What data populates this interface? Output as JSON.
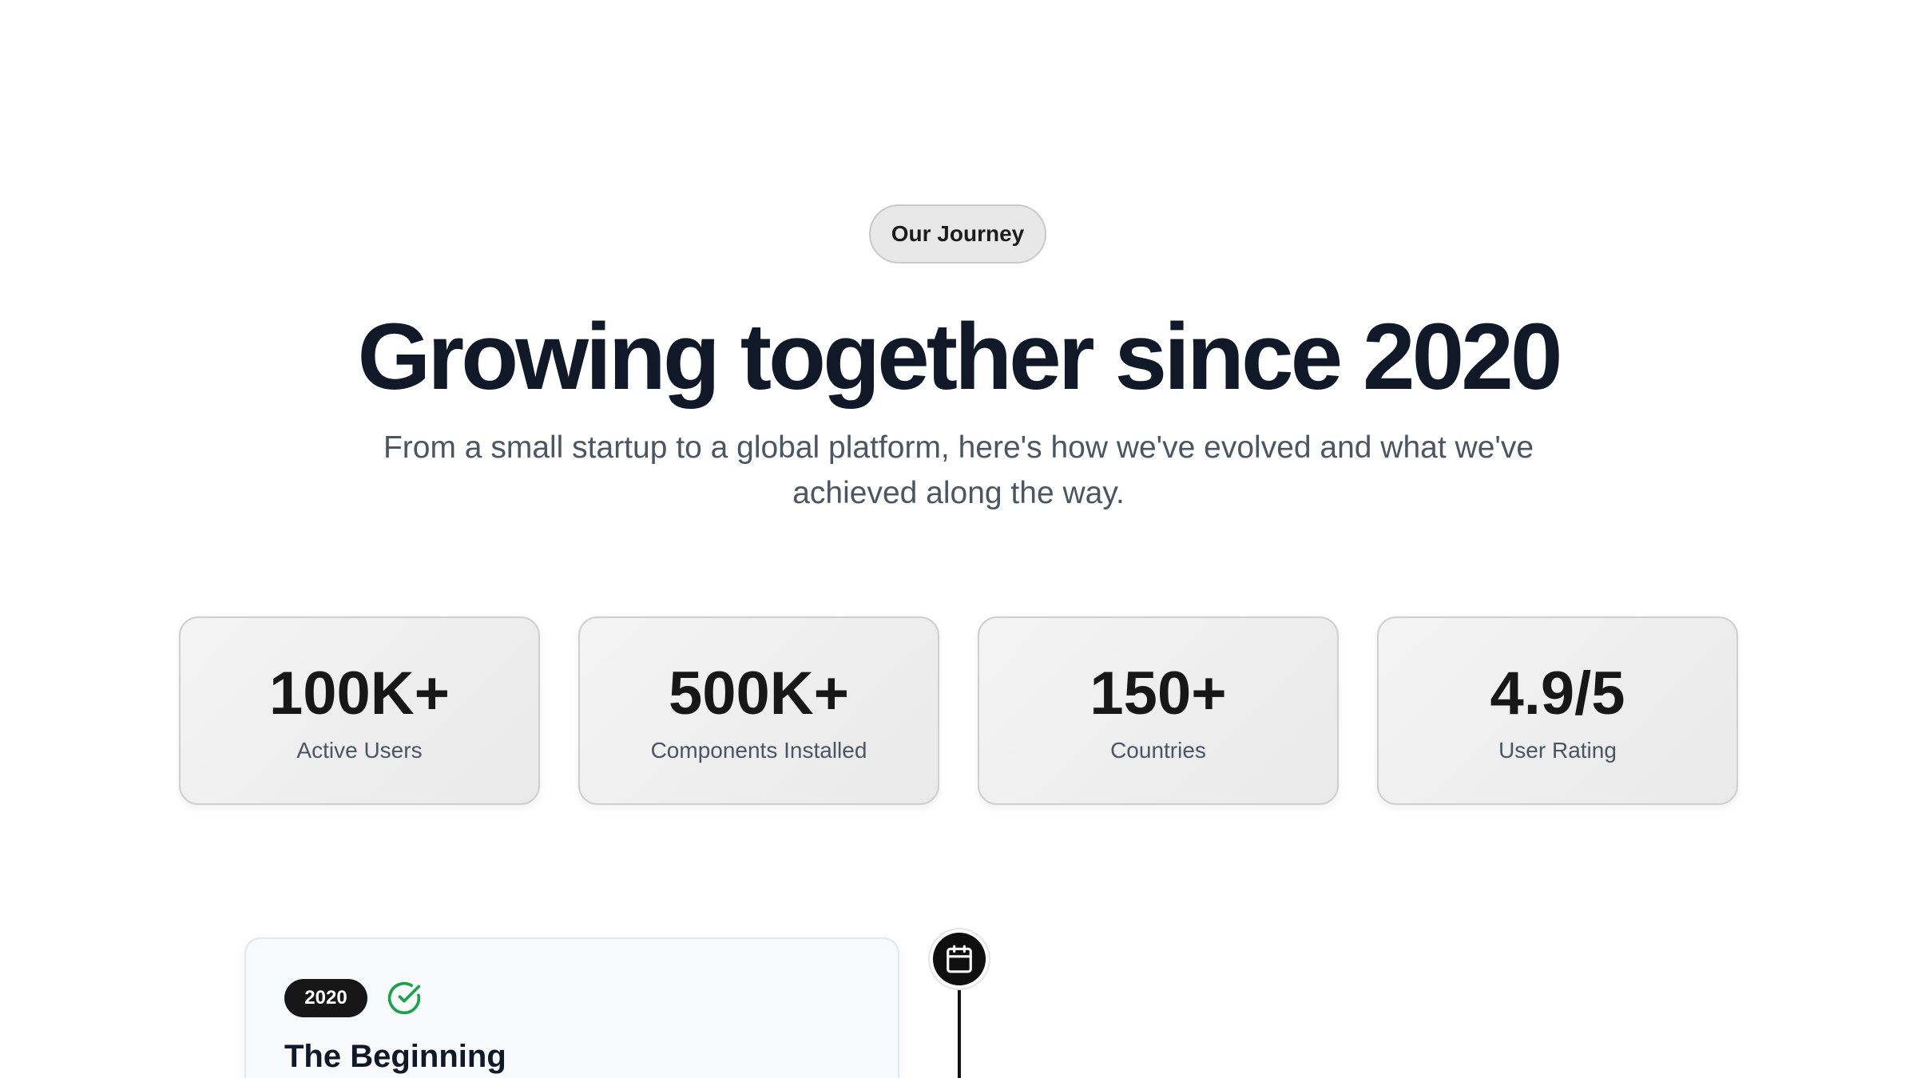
{
  "header": {
    "badge_label": "Our Journey",
    "title": "Growing together since 2020",
    "subtitle": "From a small startup to a global platform, here's how we've evolved and what we've achieved along the way."
  },
  "stats": [
    {
      "value": "100K+",
      "label": "Active Users"
    },
    {
      "value": "500K+",
      "label": "Components Installed"
    },
    {
      "value": "150+",
      "label": "Countries"
    },
    {
      "value": "4.9/5",
      "label": "User Rating"
    }
  ],
  "timeline": {
    "marker_icon": "calendar-icon",
    "milestones": [
      {
        "year": "2020",
        "status_icon": "check-circle-icon",
        "title": "The Beginning"
      }
    ]
  },
  "colors": {
    "heading": "#111827",
    "body_text": "#4b5563",
    "year_pill": "#171717",
    "check_green": "#16a34a",
    "timeline": "#111111"
  }
}
